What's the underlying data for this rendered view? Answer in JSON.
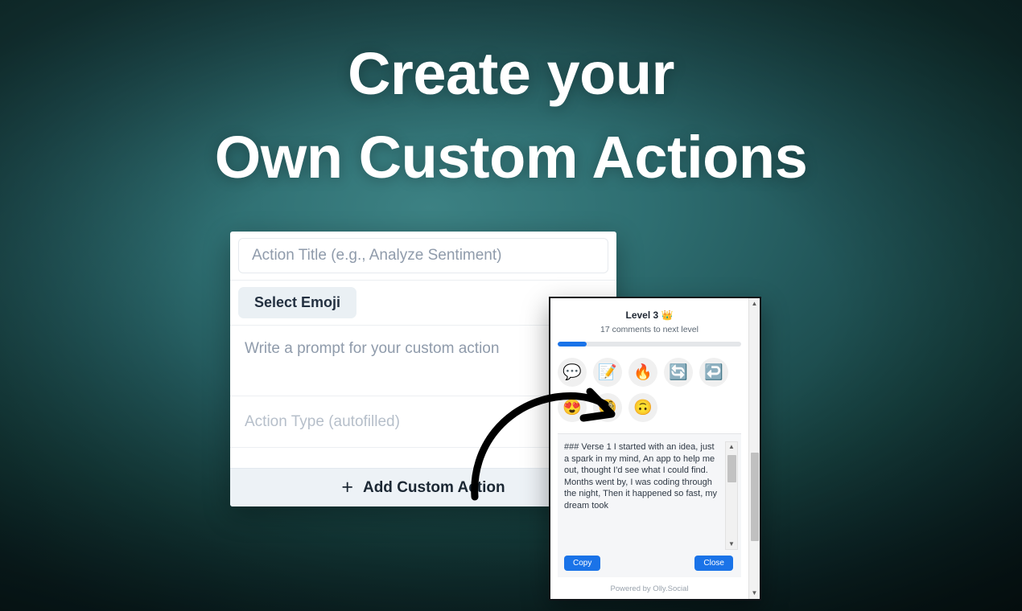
{
  "headline": {
    "line1": "Create your",
    "line2": "Own Custom Actions"
  },
  "colors": {
    "background_dark": "#050a0b",
    "background_teal": "#3c8183",
    "accent_blue": "#1a73e8",
    "card_white": "#ffffff",
    "footer_gray": "#edf2f6",
    "chip_gray": "#eaf0f4"
  },
  "action_card": {
    "title_field": {
      "placeholder": "Action Title (e.g., Analyze Sentiment)",
      "value": ""
    },
    "emoji_chip_label": "Select Emoji",
    "prompt_field": {
      "placeholder": "Write a prompt for your custom action",
      "value": ""
    },
    "type_field": {
      "placeholder": "Action Type (autofilled)",
      "value": ""
    },
    "footer": {
      "plus_icon": "+",
      "add_label": "Add Custom Action"
    }
  },
  "popup": {
    "level_title": "Level 3",
    "level_emoji": "👑",
    "level_subtitle": "17 comments to next level",
    "progress_percent": 16,
    "icon_rows": [
      [
        {
          "name": "comment-icon",
          "glyph": "💬"
        },
        {
          "name": "memo-icon",
          "glyph": "📝"
        },
        {
          "name": "fire-icon",
          "glyph": "🔥"
        },
        {
          "name": "refresh-icon",
          "glyph": "🔄"
        },
        {
          "name": "reply-icon",
          "glyph": "↩️"
        }
      ],
      [
        {
          "name": "heart-eyes-icon",
          "glyph": "😍"
        },
        {
          "name": "monocle-icon",
          "glyph": "🧐"
        },
        {
          "name": "upside-down-icon",
          "glyph": "🙃"
        }
      ]
    ],
    "result_text": "### Verse 1 I started with an idea, just a spark in my mind, An app to help me out, thought I'd see what I could find. Months went by, I was coding through the night, Then it happened so fast, my dream took",
    "copy_label": "Copy",
    "close_label": "Close",
    "footer_text": "Powered by Olly.Social",
    "scroll_up_glyph": "▲",
    "scroll_down_glyph": "▼"
  }
}
